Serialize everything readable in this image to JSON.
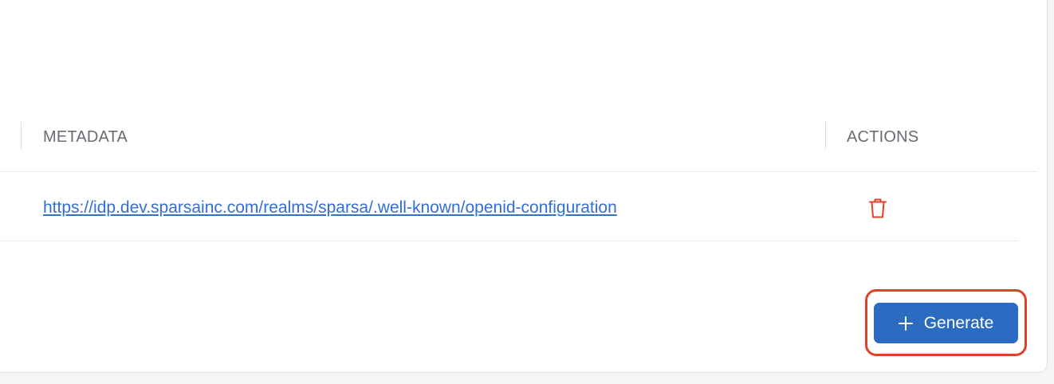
{
  "table": {
    "headers": {
      "metadata": "METADATA",
      "actions": "ACTIONS"
    },
    "rows": [
      {
        "metadata_url": "https://idp.dev.sparsainc.com/realms/sparsa/.well-known/openid-configuration",
        "action_icon": "trash-icon"
      }
    ]
  },
  "footer": {
    "generate_label": "Generate",
    "generate_icon": "plus-icon"
  },
  "colors": {
    "link": "#2f6fd6",
    "delete": "#e0412b",
    "primary_button": "#2c6bc2",
    "highlight": "#e0412b"
  }
}
